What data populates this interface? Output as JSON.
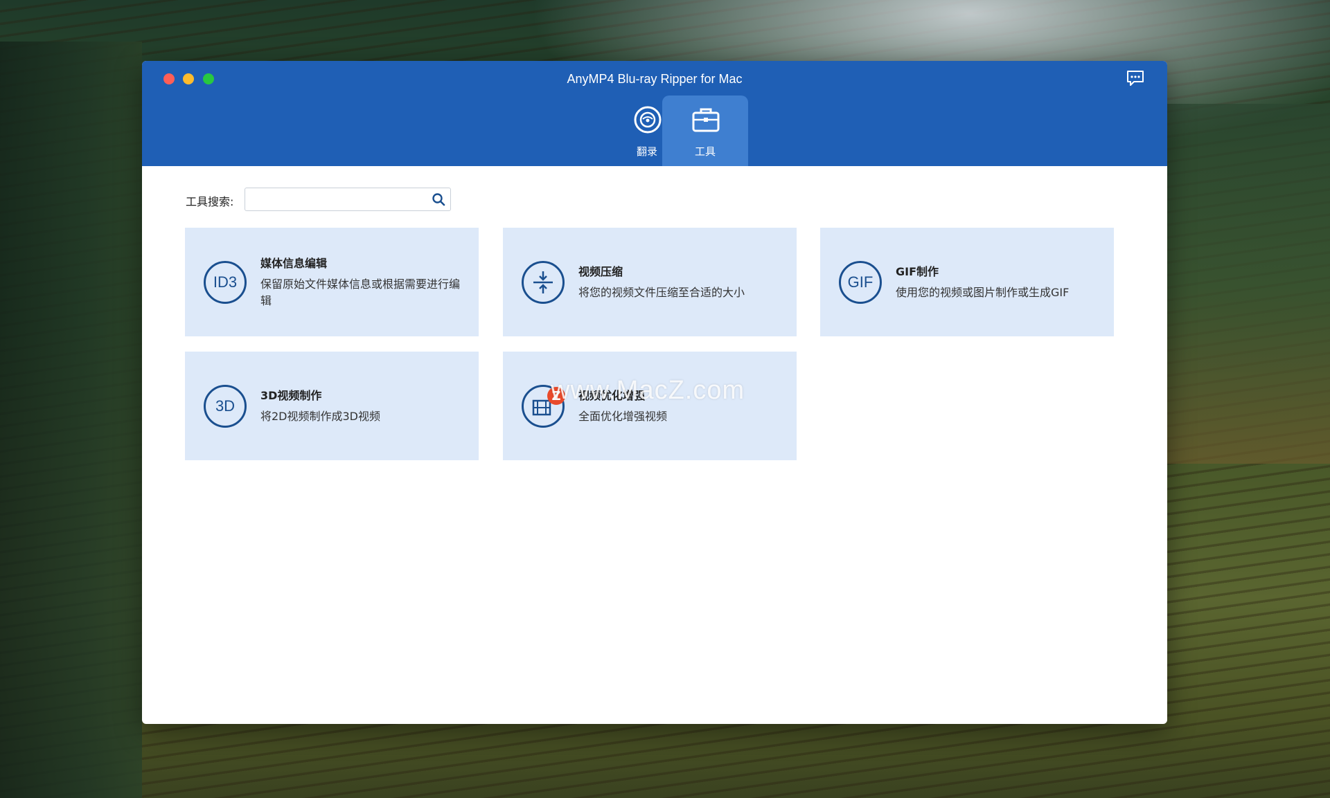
{
  "window": {
    "title": "AnyMP4 Blu-ray Ripper for Mac"
  },
  "tabs": [
    {
      "label": "翻录",
      "icon": "disc-icon"
    },
    {
      "label": "工具",
      "icon": "toolbox-icon"
    }
  ],
  "search": {
    "label": "工具搜索:",
    "value": "",
    "placeholder": ""
  },
  "tools": [
    {
      "icon_text": "ID3",
      "title": "媒体信息编辑",
      "description": "保留原始文件媒体信息或根据需要进行编辑"
    },
    {
      "icon_text": "",
      "title": "视频压缩",
      "description": "将您的视频文件压缩至合适的大小"
    },
    {
      "icon_text": "GIF",
      "title": "GIF制作",
      "description": "使用您的视频或图片制作或生成GIF"
    },
    {
      "icon_text": "3D",
      "title": "3D视频制作",
      "description": "将2D视频制作成3D视频"
    },
    {
      "icon_text": "",
      "title": "视频优化增强",
      "description": "全面优化增强视频"
    }
  ],
  "watermark": {
    "text": "www.MacZ.com",
    "logo": "Z"
  },
  "colors": {
    "titlebar": "#1f5fb5",
    "active_tab": "#3f7fd0",
    "card": "#dde9f9",
    "icon": "#1a4f8f"
  }
}
